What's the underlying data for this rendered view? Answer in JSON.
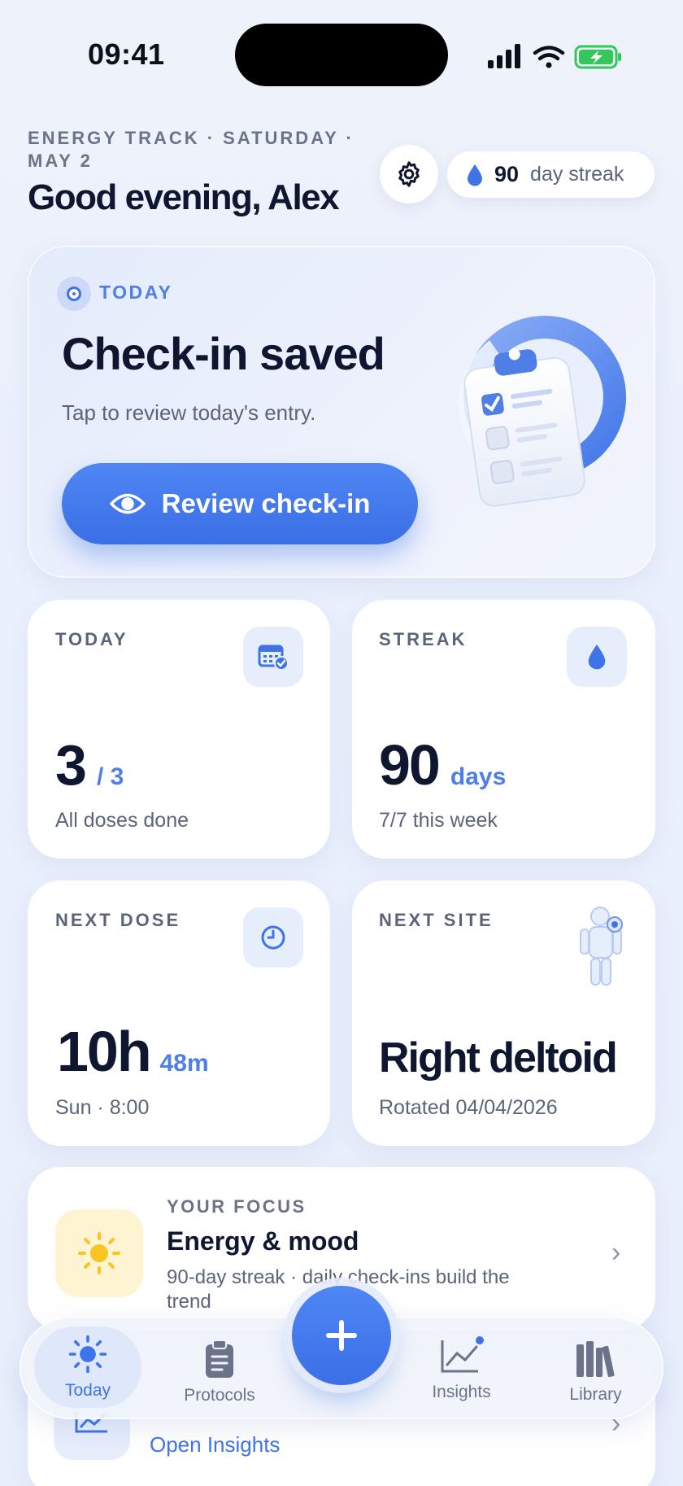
{
  "status_bar": {
    "time": "09:41"
  },
  "header": {
    "eyebrow": "ENERGY TRACK · SATURDAY · MAY 2",
    "greeting": "Good evening, Alex",
    "streak_count": "90",
    "streak_label": "day streak"
  },
  "hero": {
    "tag": "TODAY",
    "title": "Check-in saved",
    "subtitle": "Tap to review today's entry.",
    "button_label": "Review check-in"
  },
  "cards": {
    "today": {
      "label": "TODAY",
      "value": "3",
      "unit": "/ 3",
      "footer": "All doses done"
    },
    "streak": {
      "label": "STREAK",
      "value": "90",
      "unit": "days",
      "footer": "7/7 this week"
    },
    "next_dose": {
      "label": "NEXT DOSE",
      "value": "10h",
      "unit": "48m",
      "footer": "Sun · 8:00"
    },
    "next_site": {
      "label": "NEXT SITE",
      "value": "Right deltoid",
      "footer": "Rotated 04/04/2026"
    }
  },
  "focus": {
    "label": "YOUR FOCUS",
    "title": "Energy & mood",
    "subtitle": "90-day streak · daily check-ins build the trend"
  },
  "insights_card": {
    "link": "Open Insights"
  },
  "tabbar": {
    "items": [
      {
        "label": "Today",
        "icon": "sun-icon",
        "active": true
      },
      {
        "label": "Protocols",
        "icon": "clipboard-icon"
      },
      {
        "label": "Insights",
        "icon": "chart-icon",
        "badge": true
      },
      {
        "label": "Library",
        "icon": "books-icon"
      }
    ]
  },
  "colors": {
    "accent": "#3e74e8",
    "background": "#eef2fb",
    "card": "#ffffff",
    "focus_icon_bg": "#fff4d2"
  }
}
